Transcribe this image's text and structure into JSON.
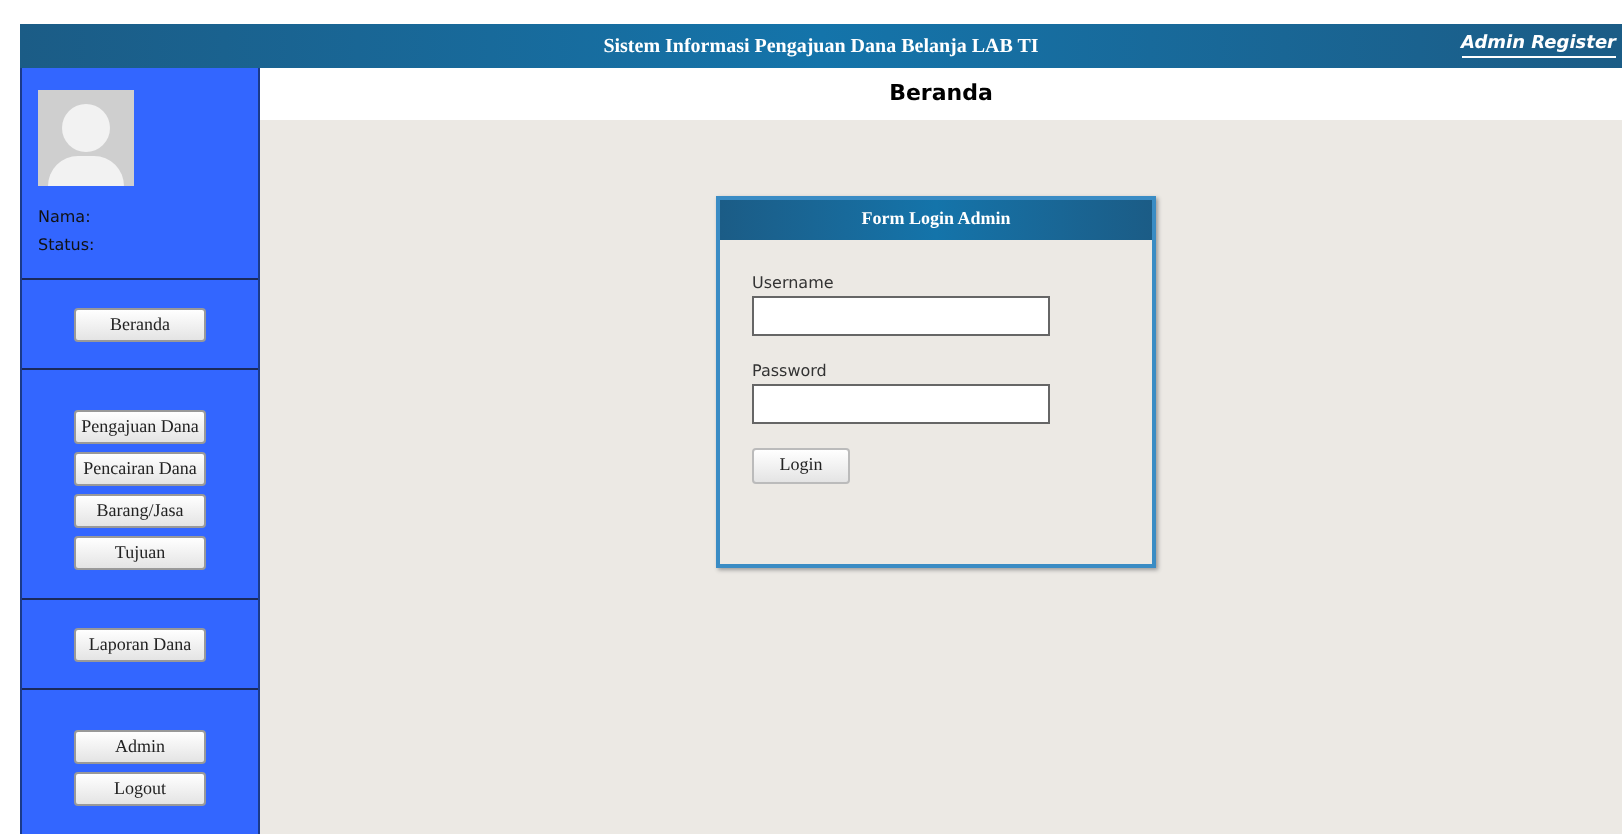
{
  "header": {
    "title": "Sistem Informasi Pengajuan Dana Belanja LAB TI",
    "link": "Admin Register"
  },
  "sidebar": {
    "profile": {
      "name_label": "Nama:",
      "status_label": "Status:"
    },
    "sections": [
      {
        "buttons": [
          "Beranda"
        ]
      },
      {
        "buttons": [
          "Pengajuan Dana",
          "Pencairan Dana",
          "Barang/Jasa",
          "Tujuan"
        ]
      },
      {
        "buttons": [
          "Laporan Dana"
        ]
      },
      {
        "buttons": [
          "Admin",
          "Logout"
        ]
      }
    ]
  },
  "page_title": "Beranda",
  "login_form": {
    "title": "Form Login Admin",
    "fields": [
      {
        "label": "Username"
      },
      {
        "label": "Password"
      }
    ],
    "submit": "Login"
  }
}
